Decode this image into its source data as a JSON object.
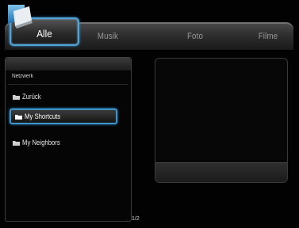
{
  "tabs": {
    "active": "Alle",
    "musik": "Musik",
    "foto": "Foto",
    "filme": "Filme"
  },
  "browser": {
    "path": "Netzwerk",
    "items": [
      {
        "label": "Zurück"
      },
      {
        "label": "My Shortcuts",
        "selected": true
      },
      {
        "label": "My Neighbors"
      }
    ],
    "page_number": "1/2"
  },
  "colors": {
    "selection_border": "#3e95cc",
    "background": "#020202"
  },
  "icons": {
    "logo": "folder-logo-icon",
    "item": "folder-icon"
  }
}
